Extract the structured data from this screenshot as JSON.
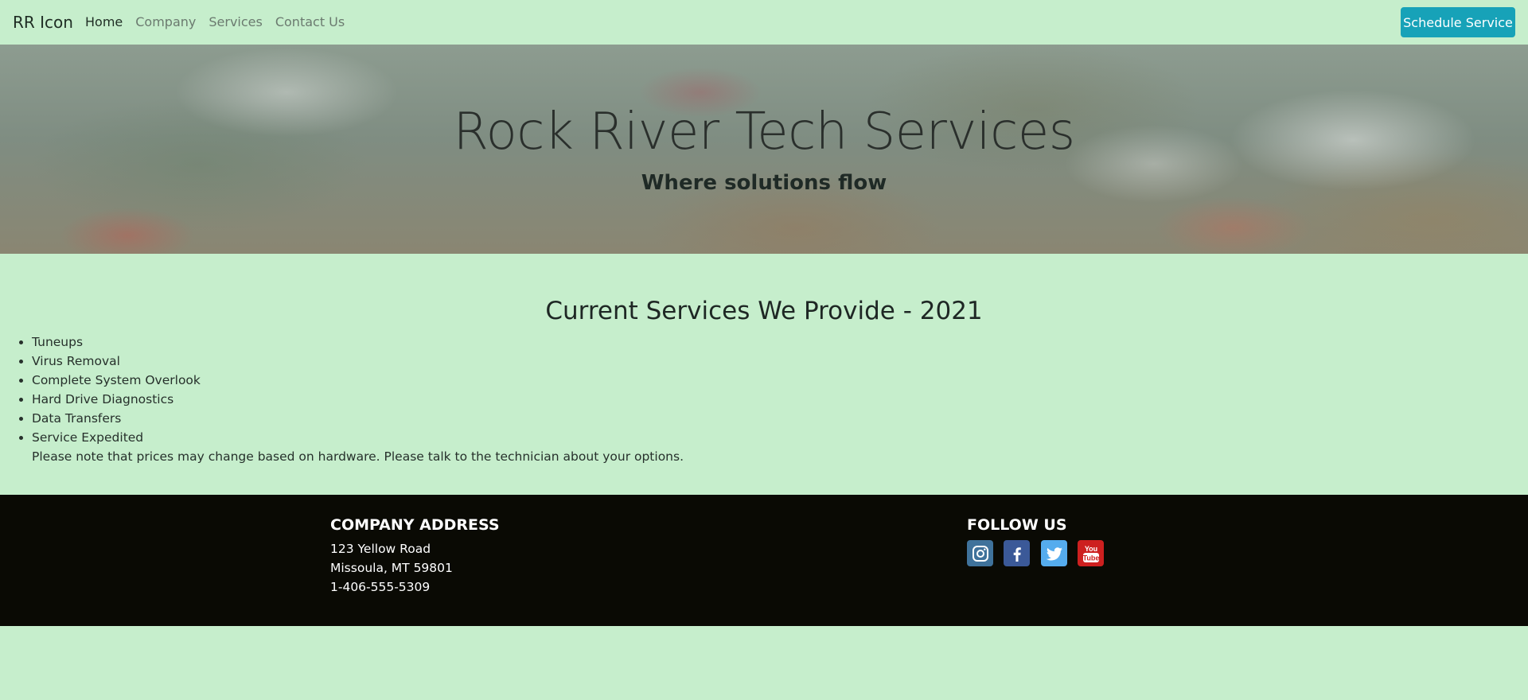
{
  "navbar": {
    "brand": "RR Icon",
    "links": [
      "Home",
      "Company",
      "Services",
      "Contact Us"
    ],
    "active_link": "Home",
    "cta_label": "Schedule Service"
  },
  "hero": {
    "title": "Rock River Tech Services",
    "subtitle": "Where solutions flow"
  },
  "services": {
    "heading": "Current Services We Provide - 2021",
    "items": [
      "Tuneups",
      "Virus Removal",
      "Complete System Overlook",
      "Hard Drive Diagnostics",
      "Data Transfers",
      "Service Expedited"
    ],
    "note": "Please note that prices may change based on hardware. Please talk to the technician about your options."
  },
  "footer": {
    "address_heading": "COMPANY ADDRESS",
    "address_lines": [
      "123 Yellow Road",
      "Missoula, MT 59801",
      "1-406-555-5309"
    ],
    "follow_heading": "FOLLOW US",
    "social_icons": [
      "instagram-icon",
      "facebook-icon",
      "twitter-icon",
      "youtube-icon"
    ]
  },
  "colors": {
    "page_background": "#c6eecc",
    "button_accent": "#17a2b8",
    "footer_background": "#0a0a04"
  }
}
